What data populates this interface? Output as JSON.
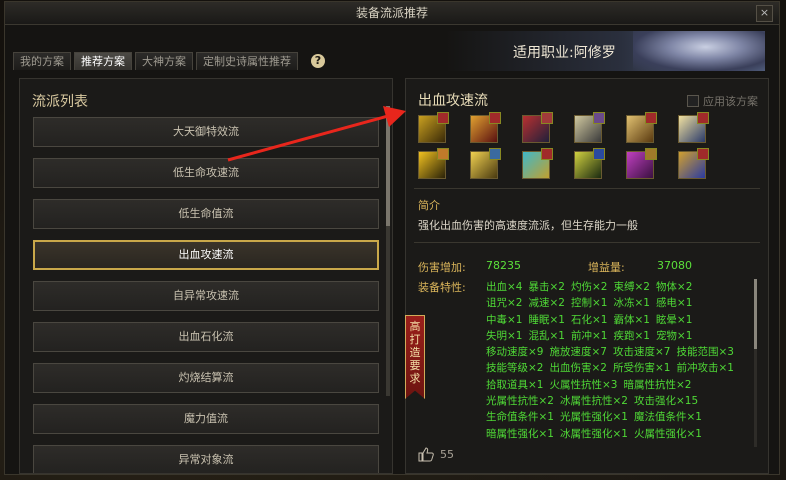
{
  "window": {
    "title": "装备流派推荐",
    "close": "×"
  },
  "tabs": [
    "我的方案",
    "推荐方案",
    "大神方案",
    "定制史诗属性推荐"
  ],
  "help": "?",
  "banner": {
    "job": "适用职业:阿修罗"
  },
  "left": {
    "heading": "流派列表",
    "items": [
      "大天御特效流",
      "低生命攻速流",
      "低生命值流",
      "出血攻速流",
      "自异常攻速流",
      "出血石化流",
      "灼烧结算流",
      "魔力值流",
      "异常对象流"
    ],
    "selected_index": 3
  },
  "right": {
    "title": "出血攻速流",
    "apply_label": "应用该方案",
    "intro_heading": "简介",
    "intro": "强化出血伤害的高速度流派，但生存能力一般",
    "damage_label": "伤害增加:",
    "damage_value": "78235",
    "gain_label": "增益量:",
    "gain_value": "37080",
    "traits_label": "装备特性:",
    "trait_rows": [
      [
        "出血×4",
        "暴击×2",
        "灼伤×2",
        "束缚×2",
        "物体×2"
      ],
      [
        "诅咒×2",
        "减速×2",
        "控制×1",
        "冰冻×1",
        "感电×1"
      ],
      [
        "中毒×1",
        "睡眠×1",
        "石化×1",
        "霸体×1",
        "眩晕×1"
      ],
      [
        "失明×1",
        "混乱×1",
        "前冲×1",
        "疾跑×1",
        "宠物×1"
      ],
      [
        "移动速度×9",
        "施放速度×7",
        "攻击速度×7",
        "技能范围×3"
      ],
      [
        "技能等级×2",
        "出血伤害×2",
        "所受伤害×1",
        "前冲攻击×1"
      ],
      [
        "拾取道具×1",
        "火属性抗性×3",
        "暗属性抗性×2"
      ],
      [
        "光属性抗性×2",
        "冰属性抗性×2",
        "攻击强化×15"
      ],
      [
        "生命值条件×1",
        "光属性强化×1",
        "魔法值条件×1"
      ],
      [
        "暗属性强化×1",
        "冰属性强化×1",
        "火属性强化×1"
      ]
    ],
    "likes": "55",
    "vertical_banner": "高打造要求"
  },
  "colors": {
    "accent_gold": "#c9a84a",
    "trait_green": "#4fd936",
    "label_gold": "#d9b45a",
    "arrow_red": "#e8261c"
  }
}
